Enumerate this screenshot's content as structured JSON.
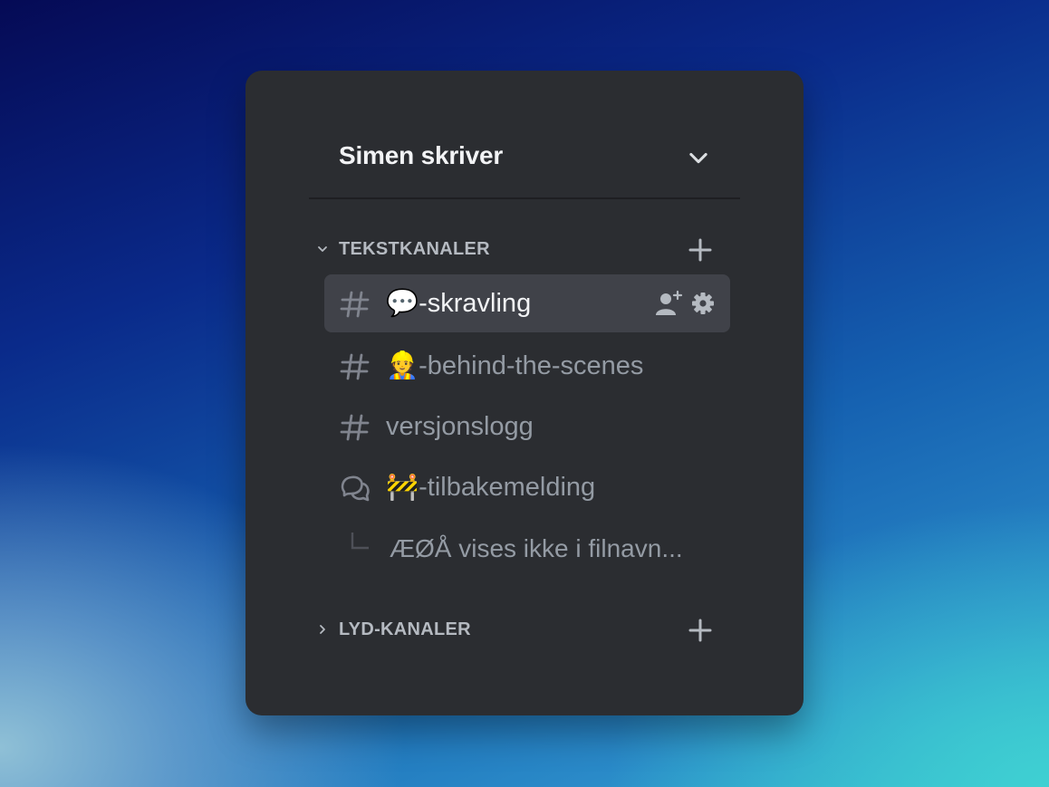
{
  "server": {
    "name": "Simen skriver"
  },
  "categories": [
    {
      "label": "TEKSTKANALER",
      "expanded": true,
      "channels": [
        {
          "type": "text",
          "label": "💬-skravling",
          "selected": true
        },
        {
          "type": "text",
          "label": "👷-behind-the-scenes",
          "selected": false
        },
        {
          "type": "text",
          "label": "versjonslogg",
          "selected": false
        },
        {
          "type": "forum",
          "label": "🚧-tilbakemelding",
          "selected": false
        }
      ],
      "thread": {
        "label": "ÆØÅ vises ikke i filnavn..."
      }
    },
    {
      "label": "LYD-KANALER",
      "expanded": false
    }
  ],
  "icons": {
    "server_menu": "chevron-down-icon",
    "category_expanded": "chevron-down-icon",
    "category_collapsed": "chevron-right-icon",
    "add": "plus-icon",
    "text_channel": "hash-icon",
    "forum_channel": "forum-icon",
    "invite": "add-user-icon",
    "settings": "gear-icon"
  },
  "colors": {
    "panel": "#2b2d31",
    "selected_row": "#404249",
    "text_primary": "#f2f3f5",
    "text_muted": "#949ba4",
    "category_text": "#b5bac1"
  }
}
